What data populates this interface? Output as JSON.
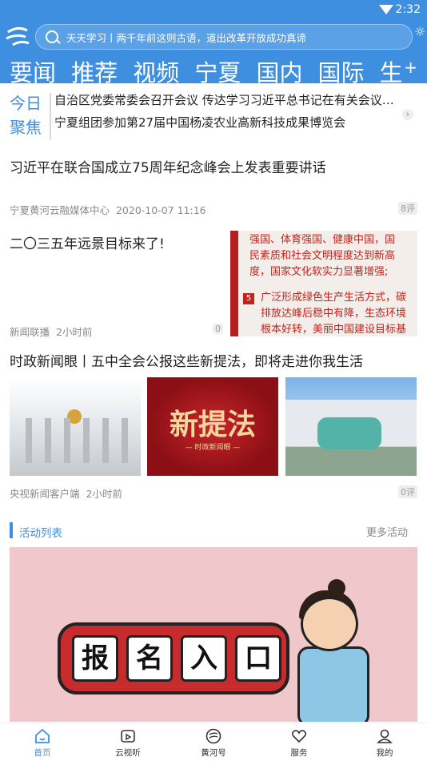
{
  "status_bar": {
    "time": "2:32"
  },
  "header": {
    "search_text": "天天学习丨两千年前这则古语，道出改革开放成功真谛",
    "tabs": [
      "要闻",
      "推荐",
      "视频",
      "宁夏",
      "国内",
      "国际",
      "生"
    ],
    "add_label": "+"
  },
  "focus": {
    "label_line1": "今日",
    "label_line2": "聚焦",
    "headline1": "自治区党委常委会召开会议 传达学习习近平总书记在有关会议…",
    "headline2": "宁夏组团参加第27届中国杨凌农业高新科技成果博览会"
  },
  "news": [
    {
      "title": "习近平在联合国成立75周年纪念峰会上发表重要讲话",
      "source": "宁夏黄河云融媒体中心",
      "time": "2020-10-07 11:16",
      "comments": "8评"
    },
    {
      "title": "二〇三五年远景目标来了!",
      "source": "新闻联播",
      "time": "2小时前",
      "comments": "0",
      "thumb_lines": [
        "强国、体育强国、健康中国，国",
        "民素质和社会文明程度达到新高",
        "度，国家文化软实力显著增强;",
        "广泛形成绿色生产生活方式，碳",
        "排放达峰后稳中有降，生态环境",
        "根本好转，美丽中国建设目标基"
      ],
      "thumb_num": "5"
    },
    {
      "title": "时政新闻眼丨五中全会公报这些新提法，即将走进你我生活",
      "source": "央视新闻客户端",
      "time": "2小时前",
      "comments": "0评",
      "image_b_big": "新提法",
      "image_b_small": "— 时政新闻眼 —"
    }
  ],
  "activity": {
    "title": "活动列表",
    "more": "更多活动",
    "banner_chars": [
      "报",
      "名",
      "入",
      "口"
    ]
  },
  "bottom_nav": [
    {
      "label": "首页",
      "icon": "home-icon",
      "active": true
    },
    {
      "label": "云视听",
      "icon": "tv-icon",
      "active": false
    },
    {
      "label": "黄河号",
      "icon": "cloud-logo-icon",
      "active": false
    },
    {
      "label": "服务",
      "icon": "heart-icon",
      "active": false
    },
    {
      "label": "我的",
      "icon": "user-icon",
      "active": false
    }
  ],
  "colors": {
    "brand": "#3f8fe0",
    "accent_red": "#c5221c"
  }
}
